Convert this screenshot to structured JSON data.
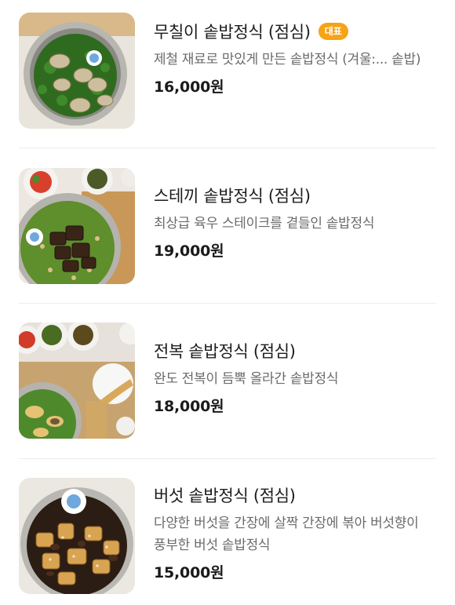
{
  "menu": {
    "items": [
      {
        "title": "무칠이 솥밥정식 (점심)",
        "badge": "대표",
        "description": "제철 재료로 맛있게 만든 솥밥정식 (겨울:... 솥밥)",
        "price": "16,000원",
        "image_icon": "oyster-rice-pot-photo"
      },
      {
        "title": "스테끼 솥밥정식 (점심)",
        "description": "최상급 육우 스테이크를 곁들인 솥밥정식",
        "price": "19,000원",
        "image_icon": "steak-rice-pot-photo"
      },
      {
        "title": "전복 솥밥정식 (점심)",
        "description": "완도 전복이 듬뿍 올라간 솥밥정식",
        "price": "18,000원",
        "image_icon": "abalone-rice-pot-photo"
      },
      {
        "title": "버섯 솥밥정식 (점심)",
        "description": "다양한 버섯을 간장에 살짝 간장에 볶아 버섯향이 풍부한 버섯 솥밥정식",
        "price": "15,000원",
        "image_icon": "mushroom-rice-pot-photo"
      }
    ]
  },
  "colors": {
    "badge": "#f6a316",
    "text": "#1c1c1c",
    "description": "#6b6b6b",
    "divider": "#ececec"
  }
}
